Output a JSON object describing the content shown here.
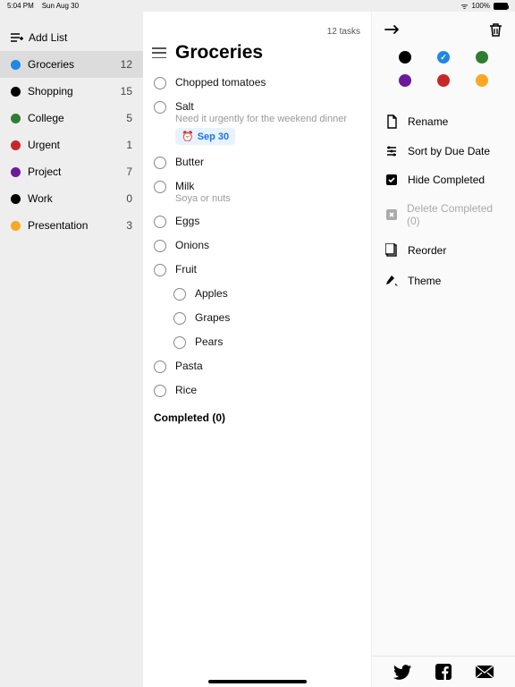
{
  "statusbar": {
    "time": "5:04 PM",
    "date": "Sun Aug 30",
    "battery": "100%"
  },
  "sidebar": {
    "add_label": "Add List",
    "items": [
      {
        "name": "Groceries",
        "count": 12,
        "color": "#1E88E5",
        "selected": true
      },
      {
        "name": "Shopping",
        "count": 15,
        "color": "#000000",
        "selected": false
      },
      {
        "name": "College",
        "count": 5,
        "color": "#2E7D32",
        "selected": false
      },
      {
        "name": "Urgent",
        "count": 1,
        "color": "#C62828",
        "selected": false
      },
      {
        "name": "Project",
        "count": 7,
        "color": "#6A1B9A",
        "selected": false
      },
      {
        "name": "Work",
        "count": 0,
        "color": "#000000",
        "selected": false
      },
      {
        "name": "Presentation",
        "count": 3,
        "color": "#F9A825",
        "selected": false
      }
    ]
  },
  "center": {
    "task_count_label": "12 tasks",
    "title": "Groceries",
    "tasks": [
      {
        "title": "Chopped tomatoes"
      },
      {
        "title": "Salt",
        "note": "Need it urgently for the weekend dinner",
        "due": "Sep 30"
      },
      {
        "title": "Butter"
      },
      {
        "title": "Milk",
        "note": "Soya or nuts"
      },
      {
        "title": "Eggs"
      },
      {
        "title": "Onions"
      },
      {
        "title": "Fruit"
      },
      {
        "title": "Apples",
        "indent": true
      },
      {
        "title": "Grapes",
        "indent": true
      },
      {
        "title": "Pears",
        "indent": true
      },
      {
        "title": "Pasta"
      },
      {
        "title": "Rice"
      }
    ],
    "completed_label": "Completed (0)"
  },
  "right": {
    "colors_row1": [
      {
        "hex": "#000000",
        "selected": false
      },
      {
        "hex": "#1E88E5",
        "selected": true
      },
      {
        "hex": "#2E7D32",
        "selected": false
      }
    ],
    "colors_row2": [
      {
        "hex": "#6A1B9A",
        "selected": false
      },
      {
        "hex": "#C62828",
        "selected": false
      },
      {
        "hex": "#F9A825",
        "selected": false
      }
    ],
    "menu": {
      "rename": "Rename",
      "sort": "Sort by Due Date",
      "hide": "Hide Completed",
      "delete": "Delete Completed (0)",
      "reorder": "Reorder",
      "theme": "Theme"
    }
  }
}
